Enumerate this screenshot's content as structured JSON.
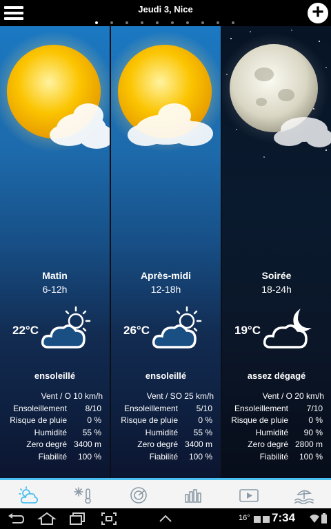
{
  "header": {
    "title": "Jeudi 3, Nice",
    "page_count": 10,
    "active_page": 1
  },
  "panels": [
    {
      "period": "Matin",
      "hours": "6-12h",
      "temperature": "22°C",
      "condition": "ensoleillé",
      "stats": {
        "wind": "Vent / O 10 km/h",
        "sunshine_label": "Ensoleillement",
        "sunshine": "8/10",
        "rain_label": "Risque de pluie",
        "rain": "0 %",
        "humidity_label": "Humidité",
        "humidity": "55 %",
        "freezing_label": "Zero degré",
        "freezing": "3400 m",
        "reliability_label": "Fiabilité",
        "reliability": "100 %"
      }
    },
    {
      "period": "Après-midi",
      "hours": "12-18h",
      "temperature": "26°C",
      "condition": "ensoleillé",
      "stats": {
        "wind": "Vent / SO 25 km/h",
        "sunshine_label": "Ensoleillement",
        "sunshine": "5/10",
        "rain_label": "Risque de pluie",
        "rain": "0 %",
        "humidity_label": "Humidité",
        "humidity": "55 %",
        "freezing_label": "Zero degré",
        "freezing": "3400 m",
        "reliability_label": "Fiabilité",
        "reliability": "100 %"
      }
    },
    {
      "period": "Soirée",
      "hours": "18-24h",
      "temperature": "19°C",
      "condition": "assez dégagé",
      "stats": {
        "wind": "Vent / O 20 km/h",
        "sunshine_label": "Ensoleillement",
        "sunshine": "7/10",
        "rain_label": "Risque de pluie",
        "rain": "0 %",
        "humidity_label": "Humidité",
        "humidity": "90 %",
        "freezing_label": "Zero degré",
        "freezing": "2800 m",
        "reliability_label": "Fiabilité",
        "reliability": "100 %"
      }
    }
  ],
  "tabs": [
    "weather-sun-cloud-icon",
    "snow-thermometer-icon",
    "radar-icon",
    "bar-chart-icon",
    "video-icon",
    "beach-icon"
  ],
  "status_bar": {
    "temperature": "16°",
    "time": "7:34"
  },
  "colors": {
    "accent": "#4ac0f0",
    "sun": "#f5b800",
    "day_sky": "#1b78c2",
    "night_sky": "#071425"
  }
}
